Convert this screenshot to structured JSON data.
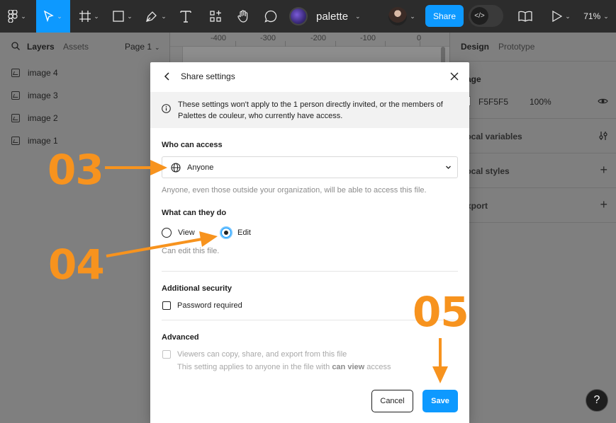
{
  "toolbar": {
    "file_name": "palette",
    "share_label": "Share",
    "zoom_level": "71%",
    "icons": [
      "figma-menu-icon",
      "move-tool-icon",
      "frame-tool-icon",
      "shape-tool-icon",
      "pen-tool-icon",
      "text-tool-icon",
      "resources-icon",
      "hand-tool-icon",
      "comment-icon",
      "library-icon",
      "present-icon",
      "dev-mode-icon"
    ]
  },
  "left_panel": {
    "tabs": [
      "Layers",
      "Assets"
    ],
    "page_selector": "Page 1",
    "layers": [
      "image 4",
      "image 3",
      "image 2",
      "image 1"
    ]
  },
  "ruler": {
    "labels": [
      "-400",
      "-300",
      "-200",
      "-100",
      "0"
    ]
  },
  "right_panel": {
    "tabs": [
      "Design",
      "Prototype"
    ],
    "section_page": "Page",
    "fill_hex": "F5F5F5",
    "fill_opacity": "100%",
    "sections": [
      "Local variables",
      "Local styles",
      "Export"
    ]
  },
  "modal": {
    "title": "Share settings",
    "info": "These settings won't apply to the 1 person directly invited, or the members of Palettes de couleur, who currently have access.",
    "who_can_access_label": "Who can access",
    "access_value": "Anyone",
    "access_hint": "Anyone, even those outside your organization, will be able to access this file.",
    "what_can_they_do_label": "What can they do",
    "options": [
      "View",
      "Edit"
    ],
    "selected_option": "Edit",
    "option_hint": "Can edit this file.",
    "additional_security_label": "Additional security",
    "password_label": "Password required",
    "password_required": false,
    "advanced_label": "Advanced",
    "viewers_copy_label": "Viewers can copy, share, and export from this file",
    "viewers_note_prefix": "This setting applies to anyone in the file with",
    "viewers_note_bold": "can view",
    "viewers_note_suffix": "access",
    "cancel_label": "Cancel",
    "save_label": "Save"
  },
  "annotations": {
    "step_03": "03",
    "step_04": "04",
    "step_05": "05",
    "color": "#f7931e"
  },
  "help_label": "?",
  "colors": {
    "accent": "#0d99ff",
    "toolbar_bg": "#2c2c2c",
    "annotation": "#f7931e"
  }
}
